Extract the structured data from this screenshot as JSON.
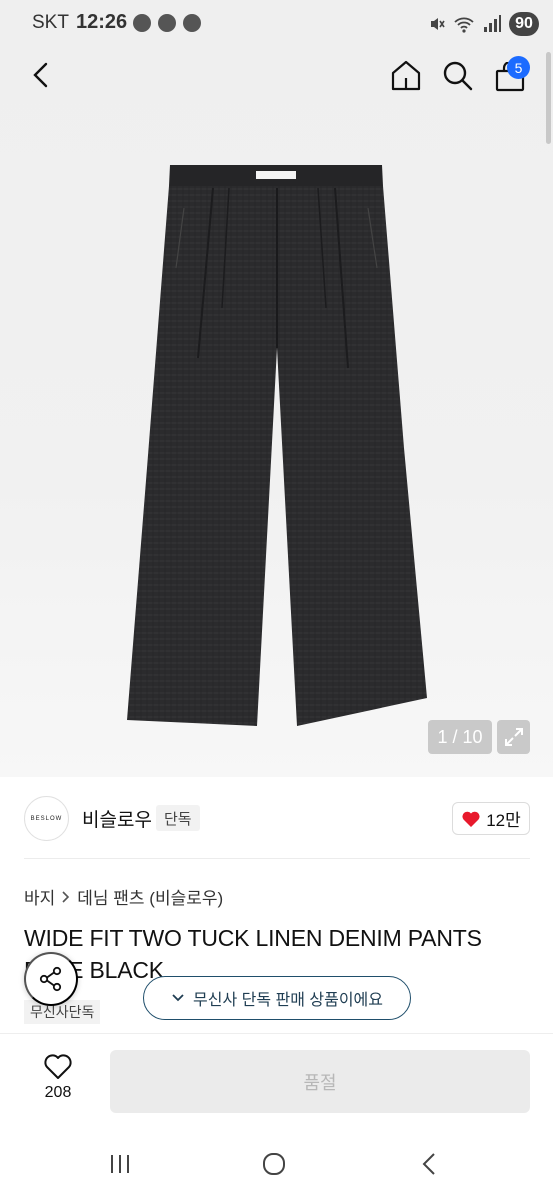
{
  "status_bar": {
    "carrier": "SKT",
    "time": "12:26",
    "battery": "90",
    "icons": [
      "chat-bubble-icon",
      "message-icon",
      "talk-icon",
      "mute-icon",
      "wifi-icon",
      "signal-icon"
    ]
  },
  "topbar": {
    "back": "back-arrow-icon",
    "home": "home-icon",
    "search": "search-icon",
    "cart": "shopping-bag-icon",
    "cart_badge": "5"
  },
  "gallery": {
    "pager": "1 / 10",
    "expand": "expand-icon"
  },
  "brand": {
    "logo_text": "BESLOW",
    "name": "비슬로우",
    "tag": "단독",
    "likes": "12만"
  },
  "breadcrumb": {
    "category": "바지",
    "sub": "데님 팬츠 (비슬로우)"
  },
  "product": {
    "title": "WIDE FIT TWO TUCK LINEN DENIM PANTS FADE BLACK",
    "exclusive_tag": "무신사단독"
  },
  "toast": {
    "text": "무신사 단독 판매 상품이에요"
  },
  "bottom": {
    "wish_count": "208",
    "buy_label": "품절"
  },
  "colors": {
    "accent": "#1c6bff",
    "heart": "#e8192c",
    "toast_border": "#1f4e6b",
    "pants": "#2a2a2c"
  }
}
